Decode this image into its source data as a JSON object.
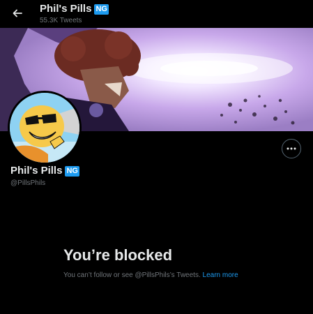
{
  "header": {
    "title": "Phil's Pills",
    "badge": "NG",
    "tweet_count": "55.3K Tweets"
  },
  "profile": {
    "name": "Phil's Pills",
    "badge": "NG",
    "handle": "@PillsPhils"
  },
  "blocked": {
    "title": "You’re blocked",
    "message": "You can’t follow or see @PillsPhils’s Tweets.",
    "link_label": "Learn more"
  },
  "icons": {
    "back": "back-arrow-icon",
    "more": "more-options-icon"
  },
  "colors": {
    "background": "#000000",
    "text_primary": "#e7e9ea",
    "text_secondary": "#71767b",
    "accent": "#1d9bf0"
  }
}
